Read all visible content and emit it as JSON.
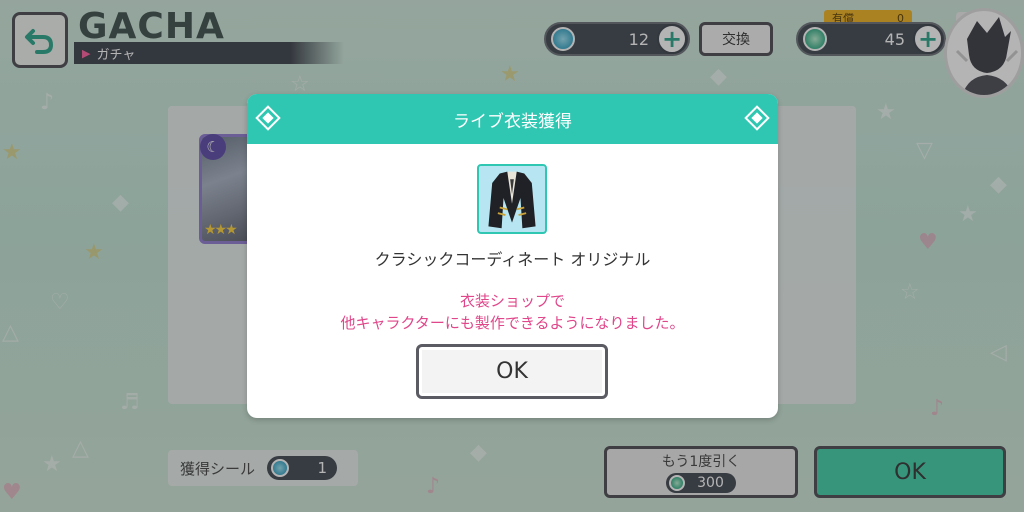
{
  "header": {
    "title": "GACHA",
    "subtitle": "ガチャ",
    "currency1_value": "12",
    "exchange_label": "交換",
    "paid_label": "有償",
    "paid_value": "0",
    "currency2_value": "45"
  },
  "bottom": {
    "seal_label": "獲得シール",
    "seal_count": "1",
    "again_label": "もう1度引く",
    "again_cost": "300",
    "ok_label": "OK"
  },
  "modal": {
    "title": "ライブ衣装獲得",
    "costume_name": "クラシックコーディネート オリジナル",
    "message_line1": "衣装ショップで",
    "message_line2": "他キャラクターにも製作できるようになりました。",
    "ok_label": "OK"
  },
  "colors": {
    "accent": "#2fc7b2",
    "message": "#e0468a",
    "ok_bottom": "#3fcfaa"
  }
}
